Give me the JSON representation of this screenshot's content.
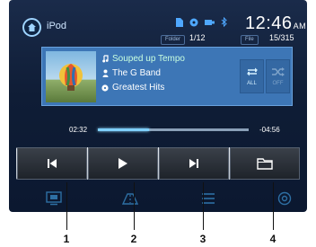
{
  "header": {
    "app_title": "iPod",
    "clock_time": "12:46",
    "clock_ampm": "AM",
    "folder_label": "Folder",
    "folder_counter": "1/12",
    "file_label": "File",
    "file_counter": "15/315",
    "icons": [
      "home-icon",
      "document-icon",
      "disc-icon",
      "usb-icon",
      "bluetooth-icon"
    ]
  },
  "track": {
    "song": "Souped up Tempo",
    "artist": "The G Band",
    "album": "Greatest Hits",
    "icons": [
      "music-note-icon",
      "person-icon",
      "album-icon"
    ]
  },
  "modes": {
    "repeat_label": "ALL",
    "shuffle_label": "OFF"
  },
  "playback": {
    "elapsed": "02:32",
    "remaining": "-04:56",
    "progress": 0.34
  },
  "transport": [
    "previous-track",
    "play",
    "next-track",
    "browse-folder"
  ],
  "bottom_nav": [
    "media-icon",
    "navigation-icon",
    "list-icon",
    "settings-icon"
  ],
  "callouts": {
    "c1": "1",
    "c2": "2",
    "c3": "3",
    "c4": "4"
  },
  "colors": {
    "screen_bg": "#0f1d36",
    "track_panel": "#3d76b6",
    "song_text": "#c9ffe0",
    "progress_fill": "#7fd0ff"
  }
}
